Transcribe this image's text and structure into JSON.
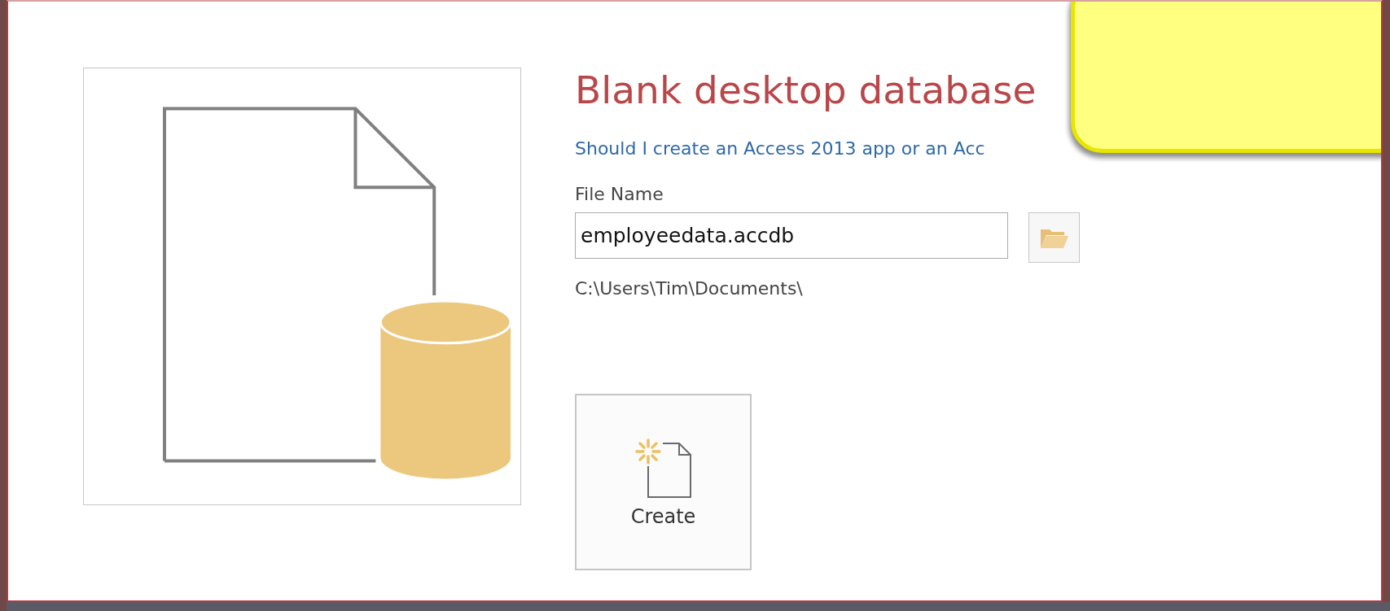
{
  "dialog": {
    "title": "Blank desktop database",
    "help_link": "Should I create an Access 2013 app or an Acc",
    "file_name_label": "File Name",
    "file_name": {
      "value": "employeedata.accdb"
    },
    "path": "C:\\Users\\Tim\\Documents\\",
    "create_button": {
      "label": "Create"
    }
  }
}
